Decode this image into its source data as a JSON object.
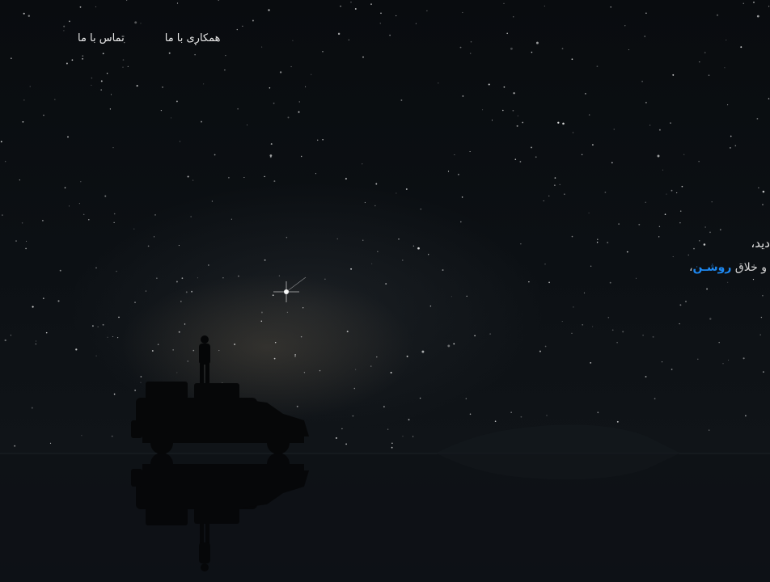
{
  "nav": {
    "items": [
      {
        "label": "تماس با ما"
      },
      {
        "label": "همکاری با ما"
      }
    ]
  },
  "hero": {
    "headline": "دید،",
    "subline_prefix": "و خلاق",
    "subline_accent": "روشـن",
    "subline_suffix": "،"
  },
  "colors": {
    "accent": "#1e88f0",
    "background": "#0b0e12",
    "text": "#e6e6e6"
  }
}
